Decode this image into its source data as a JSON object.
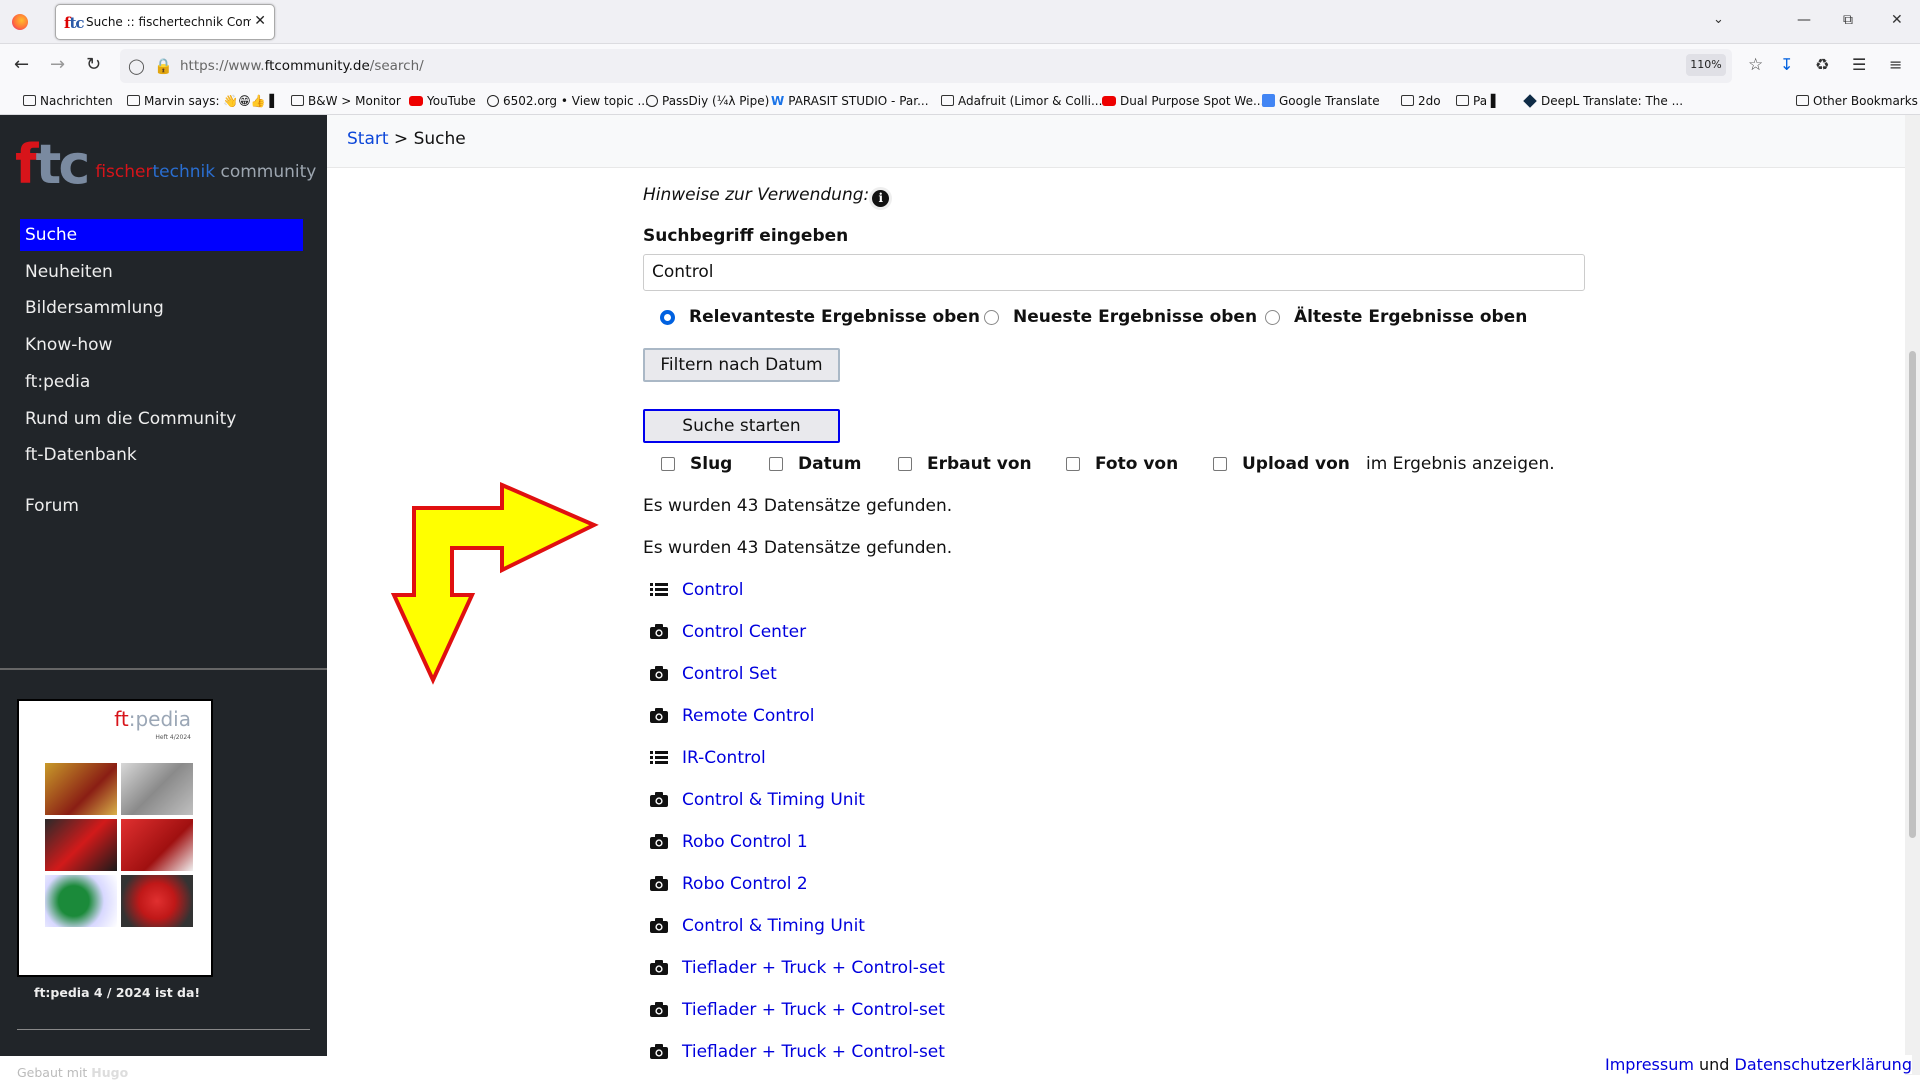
{
  "browser": {
    "tab_title": "Suche :: fischertechnik Community",
    "tab_close": "✕",
    "url_prefix": "https://www.",
    "url_domain": "ftcommunity.de",
    "url_path": "/search/",
    "zoom": "110%",
    "bookmarks": [
      {
        "label": "Nachrichten",
        "icon": "folder-icon"
      },
      {
        "label": "Marvin says: 👋😁👍 ▌",
        "icon": "folder-icon"
      },
      {
        "label": "B&W > Monitor",
        "icon": "folder-icon"
      },
      {
        "label": "YouTube",
        "icon": "youtube-icon"
      },
      {
        "label": "6502.org • View topic ...",
        "icon": "globe-icon"
      },
      {
        "label": "PassDiy (¼λ Pipe)",
        "icon": "globe-icon"
      },
      {
        "label": "PARASIT STUDIO - Par...",
        "icon": "wavy-w-icon"
      },
      {
        "label": "Adafruit (Limor & Colli...",
        "icon": "folder-icon"
      },
      {
        "label": "Dual Purpose Spot We...",
        "icon": "youtube-icon"
      },
      {
        "label": "Google Translate",
        "icon": "google-translate-icon"
      },
      {
        "label": "2do",
        "icon": "folder-icon"
      },
      {
        "label": "Pa ▌",
        "icon": "folder-icon"
      },
      {
        "label": "DeepL Translate: The ...",
        "icon": "deepl-icon"
      }
    ],
    "other_bookmarks": "Other Bookmarks"
  },
  "sidebar": {
    "logo_ftc": "ftc",
    "logo_w1": "fischer",
    "logo_w2": "technik",
    "logo_w3": " community",
    "nav": [
      "Suche",
      "Neuheiten",
      "Bildersammlung",
      "Know-how",
      "ft:pedia",
      "Rund um die Community",
      "ft-Datenbank",
      "Forum"
    ],
    "cover_title_a": "ft",
    "cover_title_b": ":pedia",
    "cover_issue": "Heft 4/2024",
    "cover_caption": "ft:pedia 4 / 2024 ist da!",
    "built_with": "Gebaut mit ",
    "built_with_tool": "Hugo"
  },
  "breadcrumb": {
    "home": "Start",
    "sep": " > ",
    "current": "Suche"
  },
  "search": {
    "hint_label": "Hinweise zur Verwendung:",
    "info_glyph": "i",
    "field_label": "Suchbegriff eingeben",
    "query": "Control",
    "sort_options": [
      "Relevanteste Ergebnisse oben",
      "Neueste Ergebnisse oben",
      "Älteste Ergebnisse oben"
    ],
    "selected_sort": 0,
    "filter_button": "Filtern nach Datum",
    "submit_button": "Suche starten",
    "show_fields": [
      "Slug",
      "Datum",
      "Erbaut von",
      "Foto von",
      "Upload von"
    ],
    "show_fields_tail": "im Ergebnis anzeigen.",
    "found_1": "Es wurden 43 Datensätze gefunden.",
    "found_2": "Es wurden 43 Datensätze gefunden."
  },
  "results": [
    {
      "title": "Control",
      "icon": "list-icon"
    },
    {
      "title": "Control Center",
      "icon": "camera-icon"
    },
    {
      "title": "Control Set",
      "icon": "camera-icon"
    },
    {
      "title": "Remote Control",
      "icon": "camera-icon"
    },
    {
      "title": "IR-Control",
      "icon": "list-icon"
    },
    {
      "title": "Control & Timing Unit",
      "icon": "camera-icon"
    },
    {
      "title": "Robo Control 1",
      "icon": "camera-icon"
    },
    {
      "title": "Robo Control 2",
      "icon": "camera-icon"
    },
    {
      "title": "Control & Timing Unit",
      "icon": "camera-icon"
    },
    {
      "title": "Tieflader + Truck + Control-set",
      "icon": "camera-icon"
    },
    {
      "title": "Tieflader + Truck + Control-set",
      "icon": "camera-icon"
    },
    {
      "title": "Tieflader + Truck + Control-set",
      "icon": "camera-icon"
    }
  ],
  "footer": {
    "impressum": "Impressum",
    "and": " und ",
    "privacy": "Datenschutzerklärung"
  },
  "colors": {
    "sidebar_bg": "#212529",
    "nav_active": "#0000ff",
    "link": "#0000dd",
    "arrow_fill": "#ffff00",
    "arrow_stroke": "#e01010"
  }
}
